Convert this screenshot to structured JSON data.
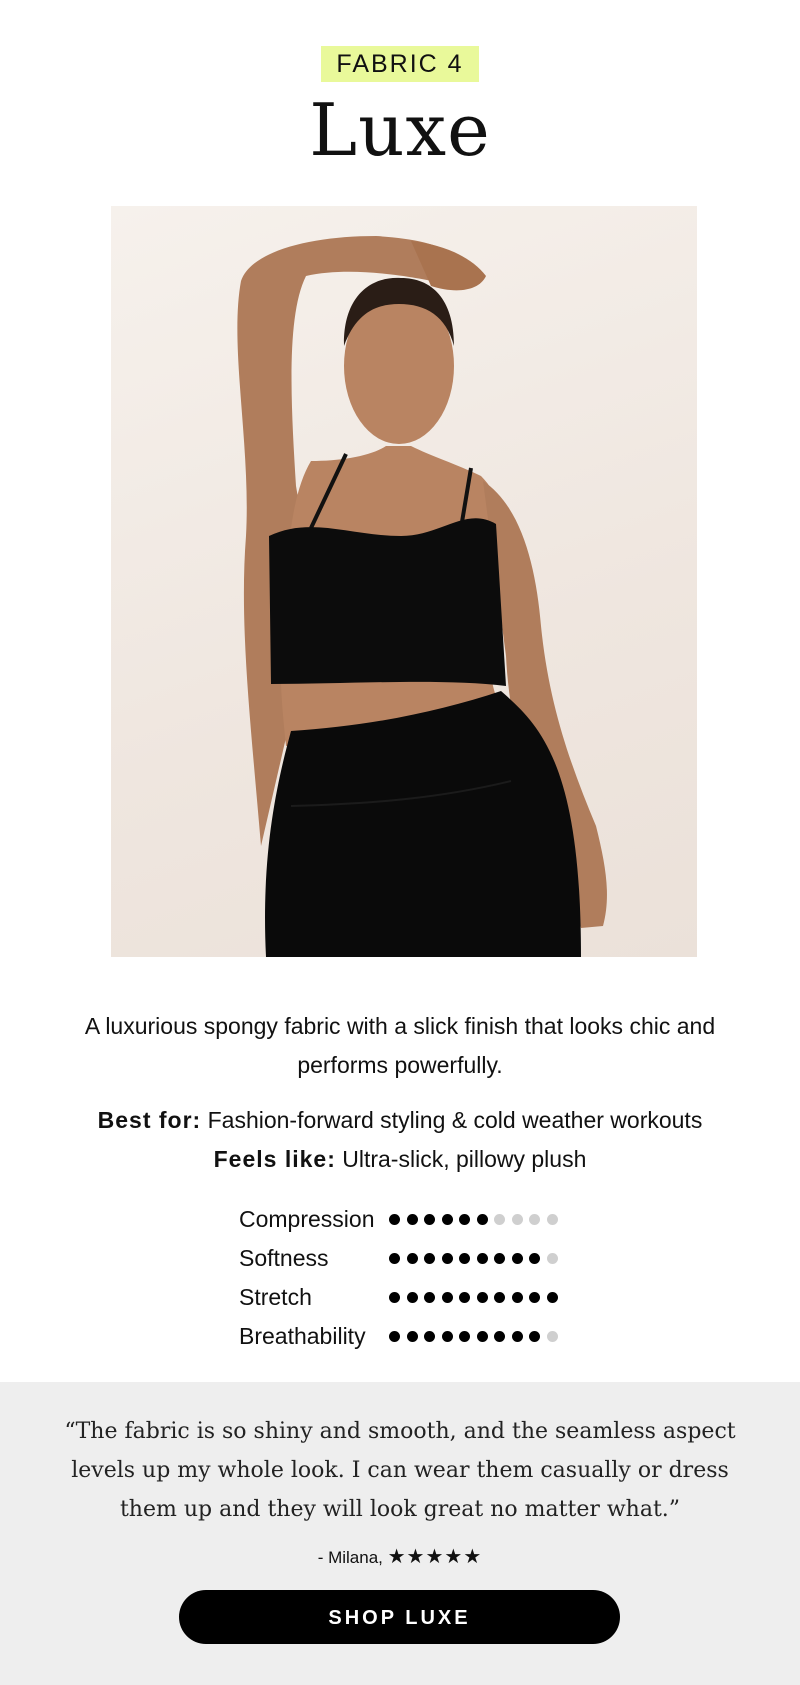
{
  "header": {
    "badge": "FABRIC 4",
    "title": "Luxe"
  },
  "hero_image": {
    "alt": "Model wearing black sports bra and high-waisted leggings"
  },
  "description": "A luxurious spongy fabric with a slick finish that looks chic and performs powerfully.",
  "best_for": {
    "label": "Best for:",
    "value": " Fashion-forward styling & cold weather workouts"
  },
  "feels_like": {
    "label": "Feels like:",
    "value": " Ultra-slick, pillowy plush"
  },
  "ratings": [
    {
      "label": "Compression",
      "score": 6,
      "max": 10
    },
    {
      "label": "Softness",
      "score": 9,
      "max": 10
    },
    {
      "label": "Stretch",
      "score": 10,
      "max": 10
    },
    {
      "label": "Breathability",
      "score": 9,
      "max": 10
    }
  ],
  "testimonial": {
    "quote": "“The fabric is so shiny and smooth, and the seamless aspect levels up my whole look. I can wear them casually or dress them up and they will look great no matter what.”",
    "author": "- Milana,",
    "stars": "★★★★★"
  },
  "cta": {
    "label": "SHOP LUXE"
  },
  "colors": {
    "badge_bg": "#e9f99a",
    "band_bg": "#eeeeee",
    "dot_on": "#000000",
    "dot_off": "#cfcfcf"
  }
}
